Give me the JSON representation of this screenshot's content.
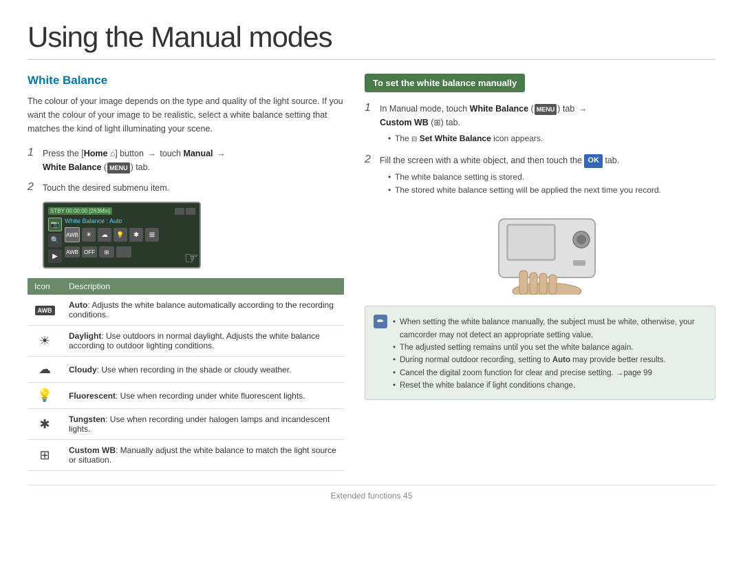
{
  "page": {
    "title": "Using the Manual modes",
    "footer": "Extended functions   45"
  },
  "left": {
    "section_title": "White Balance",
    "intro": "The colour of your image depends on the type and quality of the light source. If you want the colour of your image to be realistic, select a white balance setting that matches the kind of light illuminating your scene.",
    "step1_text": "Press the [Home",
    "step1_mid": "] button → touch Manual →",
    "step1_sub": "White Balance (",
    "step1_end": ") tab.",
    "step2_text": "Touch the desired submenu item.",
    "wb_label": "White Balance : Auto",
    "table": {
      "col1": "Icon",
      "col2": "Description",
      "rows": [
        {
          "icon_type": "box",
          "icon_label": "AWB",
          "desc_bold": "Auto",
          "desc": ": Adjusts the white balance automatically according to the recording conditions."
        },
        {
          "icon_type": "symbol",
          "icon_label": "☀",
          "desc_bold": "Daylight",
          "desc": ": Use outdoors in normal daylight. Adjusts the white balance according to outdoor lighting conditions."
        },
        {
          "icon_type": "symbol",
          "icon_label": "☁",
          "desc_bold": "Cloudy",
          "desc": ": Use when recording in the shade or cloudy weather."
        },
        {
          "icon_type": "symbol",
          "icon_label": "💡",
          "desc_bold": "Fluorescent",
          "desc": ": Use when recording under white fluorescent lights."
        },
        {
          "icon_type": "symbol",
          "icon_label": "✱",
          "desc_bold": "Tungsten",
          "desc": ": Use when recording under halogen lamps and incandescent lights."
        },
        {
          "icon_type": "symbol",
          "icon_label": "⊞",
          "desc_bold": "Custom WB",
          "desc": ": Manually adjust the white balance to match the light source or situation."
        }
      ]
    }
  },
  "right": {
    "header": "To set the white balance manually",
    "step1_bold1": "White Balance",
    "step1_icon1": "MENU",
    "step1_mid": "tab →",
    "step1_bold2": "Custom WB",
    "step1_icon2": "⊞",
    "step1_end": ") tab.",
    "step1_prefix": "In Manual mode, touch",
    "step1_bullet": "The",
    "step1_bullet_bold": "Set White Balance",
    "step1_bullet_end": "icon appears.",
    "step2_prefix": "Fill the screen with a white object, and then touch the",
    "step2_ok": "OK",
    "step2_end": "tab.",
    "step2_bullets": [
      "The white balance setting is stored.",
      "The stored white balance setting will be applied the next time you record."
    ],
    "note_bullets": [
      "When setting the white balance manually, the subject must be white, otherwise, your camcorder may not detect an appropriate setting value.",
      "The adjusted setting remains until you set the white balance again.",
      "During normal outdoor recording, setting to Auto may provide better results.",
      "Cancel the digital zoom function for clear and precise setting. →page 99",
      "Reset the white balance if light conditions change."
    ]
  }
}
